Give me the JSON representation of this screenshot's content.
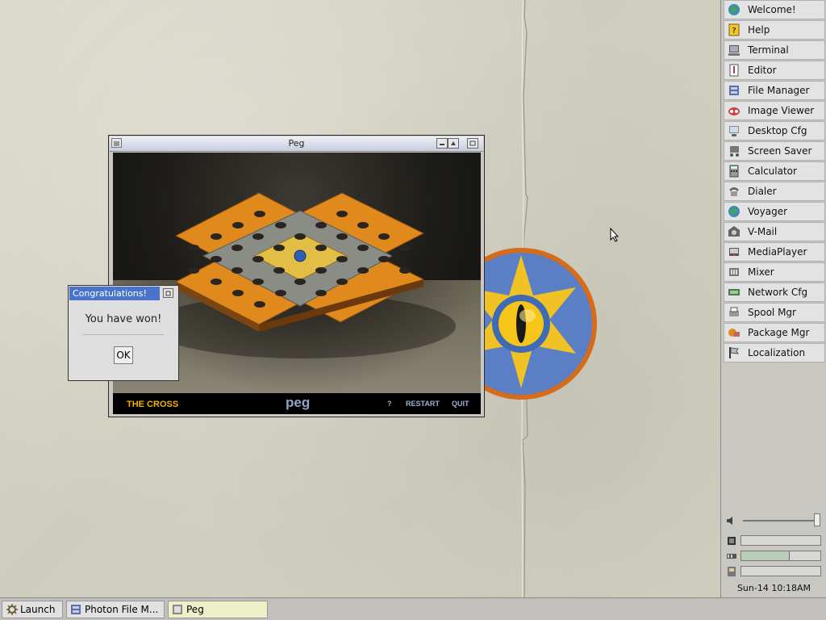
{
  "peg_window": {
    "title": "Peg",
    "footer": {
      "mode": "THE CROSS",
      "logo": "peg",
      "help": "?",
      "restart": "RESTART",
      "quit": "QUIT"
    }
  },
  "dialog": {
    "title": "Congratulations!",
    "message": "You have won!",
    "ok_label": "OK"
  },
  "shelf": {
    "items": [
      {
        "label": "Welcome!",
        "icon": "globe-icon"
      },
      {
        "label": "Help",
        "icon": "help-icon"
      },
      {
        "label": "Terminal",
        "icon": "terminal-icon"
      },
      {
        "label": "Editor",
        "icon": "editor-icon"
      },
      {
        "label": "File Manager",
        "icon": "file-manager-icon"
      },
      {
        "label": "Image Viewer",
        "icon": "image-viewer-icon"
      },
      {
        "label": "Desktop Cfg",
        "icon": "desktop-cfg-icon"
      },
      {
        "label": "Screen Saver",
        "icon": "screen-saver-icon"
      },
      {
        "label": "Calculator",
        "icon": "calculator-icon"
      },
      {
        "label": "Dialer",
        "icon": "dialer-icon"
      },
      {
        "label": "Voyager",
        "icon": "voyager-icon"
      },
      {
        "label": "V-Mail",
        "icon": "vmail-icon"
      },
      {
        "label": "MediaPlayer",
        "icon": "mediaplayer-icon"
      },
      {
        "label": "Mixer",
        "icon": "mixer-icon"
      },
      {
        "label": "Network Cfg",
        "icon": "network-cfg-icon"
      },
      {
        "label": "Spool Mgr",
        "icon": "spool-mgr-icon"
      },
      {
        "label": "Package Mgr",
        "icon": "package-mgr-icon"
      },
      {
        "label": "Localization",
        "icon": "localization-icon"
      }
    ],
    "clock": "Sun-14 10:18AM",
    "volume_level": 0.95,
    "memory_level": 0.6
  },
  "taskbar": {
    "launch_label": "Launch",
    "tasks": [
      {
        "label": "Photon File M..."
      },
      {
        "label": "Peg"
      }
    ]
  },
  "colors": {
    "accent": "#4a74c9",
    "board_orange": "#e08a1e",
    "footer_mode": "#f2b100"
  }
}
